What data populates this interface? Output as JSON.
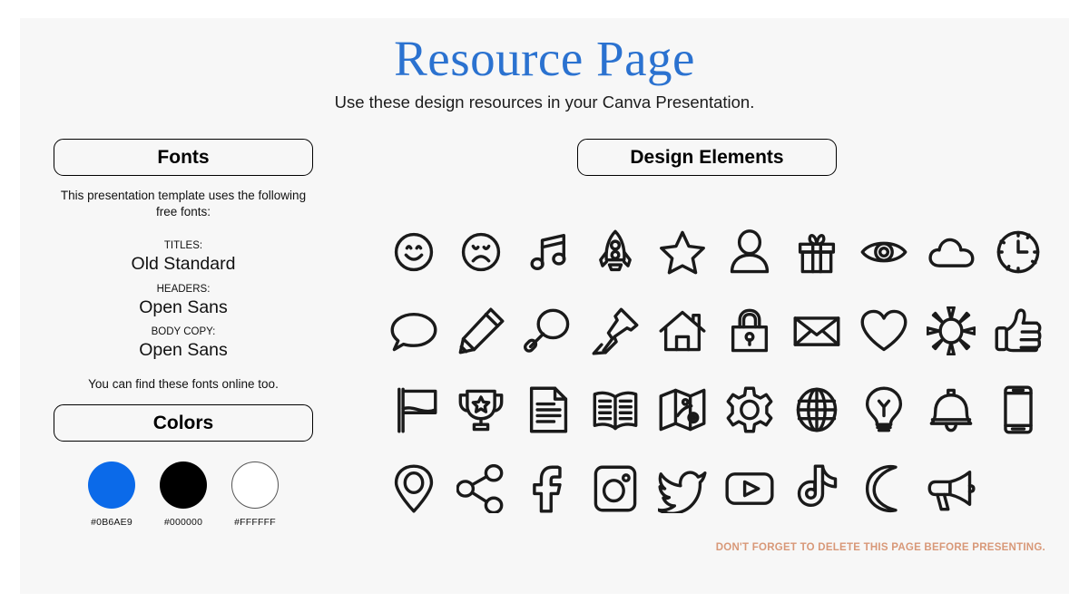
{
  "header": {
    "title": "Resource Page",
    "subtitle": "Use these design resources in your Canva Presentation.",
    "title_color": "#2B72D0"
  },
  "fonts_panel": {
    "heading": "Fonts",
    "intro": "This presentation template uses the following free fonts:",
    "entries": [
      {
        "label": "TITLES:",
        "name": "Old Standard"
      },
      {
        "label": "HEADERS:",
        "name": "Open Sans"
      },
      {
        "label": "BODY COPY:",
        "name": "Open Sans"
      }
    ],
    "outro": "You can find these fonts online too."
  },
  "colors_panel": {
    "heading": "Colors",
    "swatches": [
      {
        "hex": "#0B6AE9",
        "label": "#0B6AE9",
        "outlined": false
      },
      {
        "hex": "#000000",
        "label": "#000000",
        "outlined": false
      },
      {
        "hex": "#FFFFFF",
        "label": "#FFFFFF",
        "outlined": true
      }
    ]
  },
  "design_panel": {
    "heading": "Design Elements",
    "icons": [
      "smiley-face-icon",
      "sad-face-icon",
      "music-note-icon",
      "rocket-icon",
      "star-icon",
      "person-icon",
      "gift-icon",
      "eye-icon",
      "cloud-icon",
      "clock-icon",
      "speech-bubble-icon",
      "pencil-icon",
      "magnifying-glass-icon",
      "pushpin-icon",
      "house-icon",
      "lock-icon",
      "envelope-icon",
      "heart-icon",
      "sun-icon",
      "thumbs-up-icon",
      "flag-icon",
      "trophy-icon",
      "document-icon",
      "book-icon",
      "map-icon",
      "gear-icon",
      "globe-icon",
      "lightbulb-icon",
      "bell-icon",
      "phone-icon",
      "location-pin-icon",
      "share-icon",
      "facebook-icon",
      "instagram-icon",
      "twitter-icon",
      "youtube-icon",
      "tiktok-icon",
      "moon-icon",
      "megaphone-icon"
    ]
  },
  "footer": {
    "note": "DON'T FORGET TO DELETE THIS PAGE BEFORE PRESENTING.",
    "note_color": "#D89878"
  }
}
